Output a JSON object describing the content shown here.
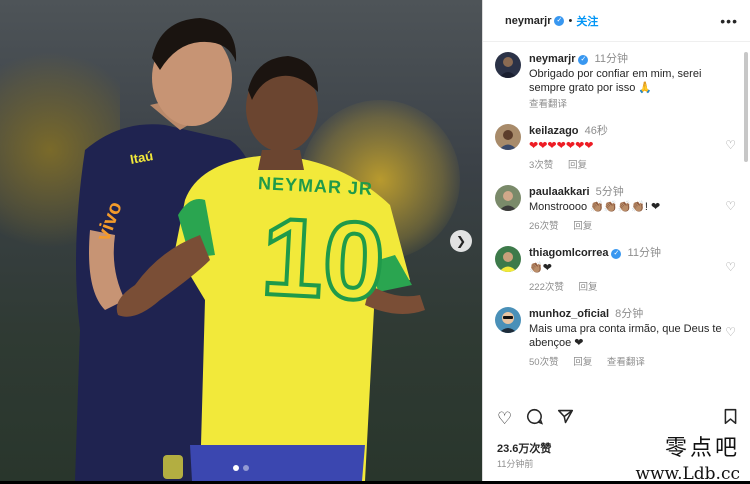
{
  "header": {
    "username": "neymarjr",
    "separator": "•",
    "follow_label": "关注",
    "more_icon": "more-horizontal-icon"
  },
  "jersey": {
    "name": "NEYMAR JR",
    "number": "10",
    "coach_sponsor_1": "Itaú",
    "coach_sponsor_2": "vivo"
  },
  "caption": {
    "username": "neymarjr",
    "time": "11分钟",
    "text": "Obrigado por confiar em mim, serei sempre grato por isso 🙏",
    "translate": "查看翻译"
  },
  "comments": [
    {
      "username": "keilazago",
      "time": "46秒",
      "text": "❤❤❤❤❤❤❤",
      "likes": "3次赞",
      "reply": "回复",
      "translate": ""
    },
    {
      "username": "paulaakkari",
      "time": "5分钟",
      "text": "Monstroooo 👏🏽👏🏽👏🏽👏🏽! ❤",
      "likes": "26次赞",
      "reply": "回复",
      "translate": ""
    },
    {
      "username": "thiagomlcorrea",
      "time": "11分钟",
      "text": "👏🏽❤",
      "likes": "222次赞",
      "reply": "回复",
      "translate": ""
    },
    {
      "username": "munhoz_oficial",
      "time": "8分钟",
      "text": "Mais uma pra conta irmão, que Deus te abençoe ❤",
      "likes": "50次赞",
      "reply": "回复",
      "translate": "查看翻译"
    }
  ],
  "footer": {
    "likes": "23.6万次赞",
    "time": "11分钟前"
  },
  "watermark": {
    "cn": "零点吧",
    "url": "www.Ldb.cc"
  },
  "colors": {
    "jersey_yellow": "#f2e93a",
    "jersey_green": "#1f9a4a",
    "coach_navy": "#1f2350",
    "follow_blue": "#0095f6",
    "heart_red": "#ed1c24"
  }
}
